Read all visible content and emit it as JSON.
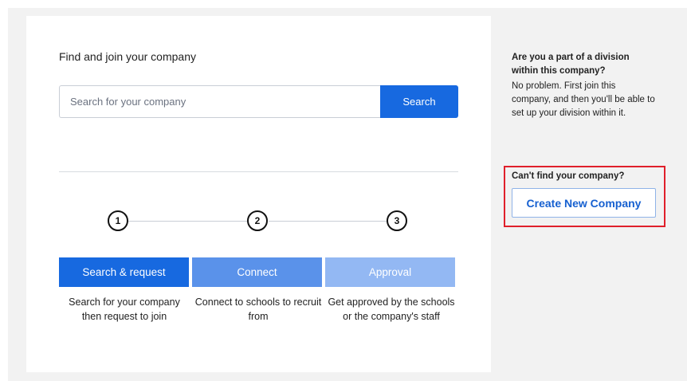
{
  "main": {
    "heading": "Find and join your company",
    "search": {
      "placeholder": "Search for your company",
      "value": "",
      "button_label": "Search"
    },
    "steps": [
      {
        "number": "1",
        "label": "Search & request",
        "description": "Search for your company then request to join",
        "color": "#1769e0"
      },
      {
        "number": "2",
        "label": "Connect",
        "description": "Connect to schools to recruit from",
        "color": "#5a92ea"
      },
      {
        "number": "3",
        "label": "Approval",
        "description": "Get approved by the schools or the company's staff",
        "color": "#93b8f3"
      }
    ]
  },
  "side": {
    "division_title": "Are you a part of a division within this company?",
    "division_text": "No problem. First join this company, and then you'll be able to set up your division within it.",
    "cant_find_label": "Can't find your company?",
    "create_button_label": "Create New Company",
    "highlight_color": "#e0202b"
  }
}
